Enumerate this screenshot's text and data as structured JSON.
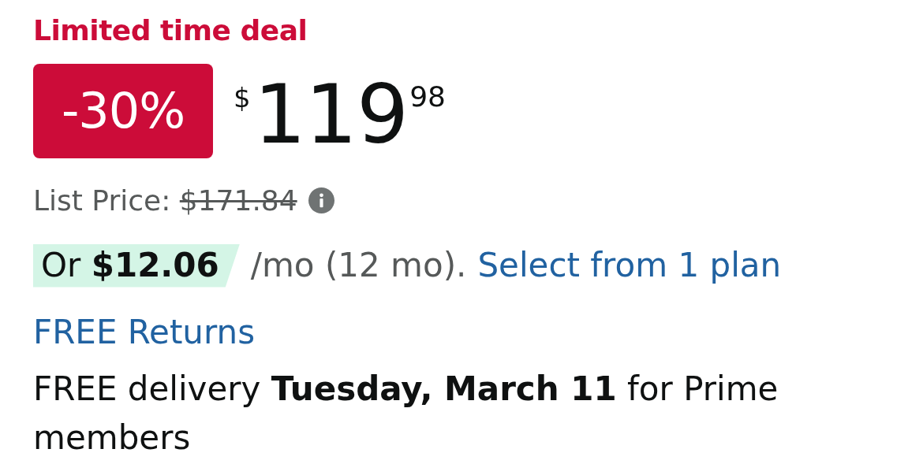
{
  "deal_label": "Limited time deal",
  "discount_badge": "-30%",
  "price": {
    "currency": "$",
    "whole": "119",
    "fraction": "98"
  },
  "list_price": {
    "label": "List Price:",
    "value": "$171.84"
  },
  "installment": {
    "offer": "Or **$12.06**",
    "terms": "/mo (12 mo).",
    "link": "Select from 1 plan"
  },
  "returns_link": "FREE Returns",
  "delivery": "FREE delivery **Tuesday, March 11** for Prime members"
}
